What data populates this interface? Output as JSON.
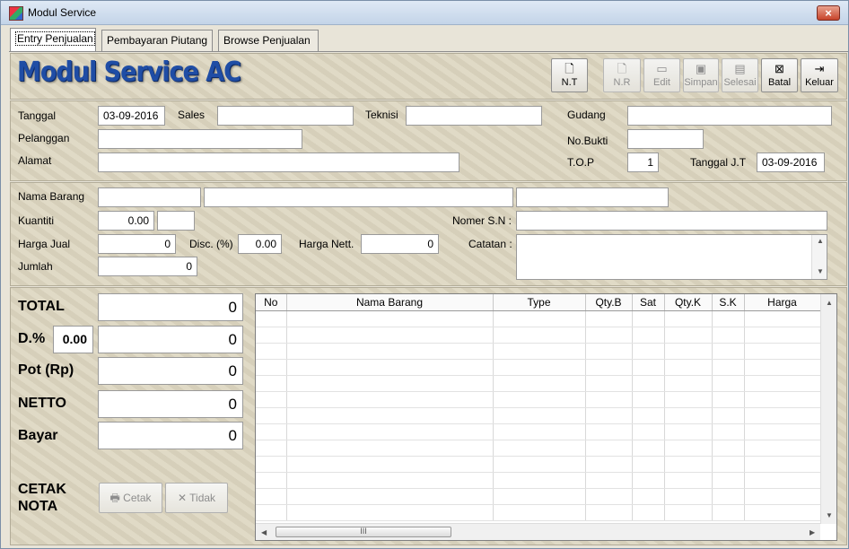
{
  "window": {
    "title": "Modul Service",
    "close_label": "×"
  },
  "tabs": [
    {
      "label": "Entry Penjualan",
      "active": true
    },
    {
      "label": "Pembayaran Piutang",
      "active": false
    },
    {
      "label": "Browse Penjualan",
      "active": false
    }
  ],
  "brand": "Modul Service AC",
  "toolbar": [
    {
      "label": "N.T",
      "icon": "new-document-icon",
      "enabled": true
    },
    {
      "label": "N.R",
      "icon": "document-icon",
      "enabled": false
    },
    {
      "label": "Edit",
      "icon": "folder-open-icon",
      "enabled": false
    },
    {
      "label": "Simpan",
      "icon": "floppy-disk-icon",
      "enabled": false
    },
    {
      "label": "Selesai",
      "icon": "finish-icon",
      "enabled": false
    },
    {
      "label": "Batal",
      "icon": "cancel-icon",
      "enabled": true
    },
    {
      "label": "Keluar",
      "icon": "exit-door-icon",
      "enabled": true
    }
  ],
  "header": {
    "tanggal_label": "Tanggal",
    "tanggal": "03-09-2016",
    "sales_label": "Sales",
    "sales": "",
    "teknisi_label": "Teknisi",
    "teknisi": "",
    "gudang_label": "Gudang",
    "gudang": "",
    "pelanggan_label": "Pelanggan",
    "pelanggan": "",
    "nobukti_label": "No.Bukti",
    "nobukti": "",
    "alamat_label": "Alamat",
    "alamat": "",
    "top_label": "T.O.P",
    "top": "1",
    "tgljt_label": "Tanggal J.T",
    "tgljt": "03-09-2016"
  },
  "item": {
    "nama_barang_label": "Nama Barang",
    "kuantiti_label": "Kuantiti",
    "kuantiti": "0.00",
    "satuan": "",
    "harga_jual_label": "Harga Jual",
    "harga_jual": "0",
    "disc_label": "Disc. (%)",
    "disc": "0.00",
    "harga_nett_label": "Harga Nett.",
    "harga_nett": "0",
    "jumlah_label": "Jumlah",
    "jumlah": "0",
    "nomer_sn_label": "Nomer S.N :",
    "nomer_sn": "",
    "catatan_label": "Catatan :",
    "catatan": ""
  },
  "totals": {
    "total_label": "TOTAL",
    "total": "0",
    "disc_label": "D.%",
    "disc_pct": "0.00",
    "disc": "0",
    "pot_label": "Pot (Rp)",
    "pot": "0",
    "netto_label": "NETTO",
    "netto": "0",
    "bayar_label": "Bayar",
    "bayar": "0",
    "cetak_nota_label": "CETAK NOTA",
    "cetak_label": "Cetak",
    "tidak_label": "Tidak"
  },
  "grid": {
    "columns": [
      "No",
      "Nama Barang",
      "Type",
      "Qty.B",
      "Sat",
      "Qty.K",
      "S.K",
      "Harga"
    ],
    "hscroll_thumb": "III"
  }
}
